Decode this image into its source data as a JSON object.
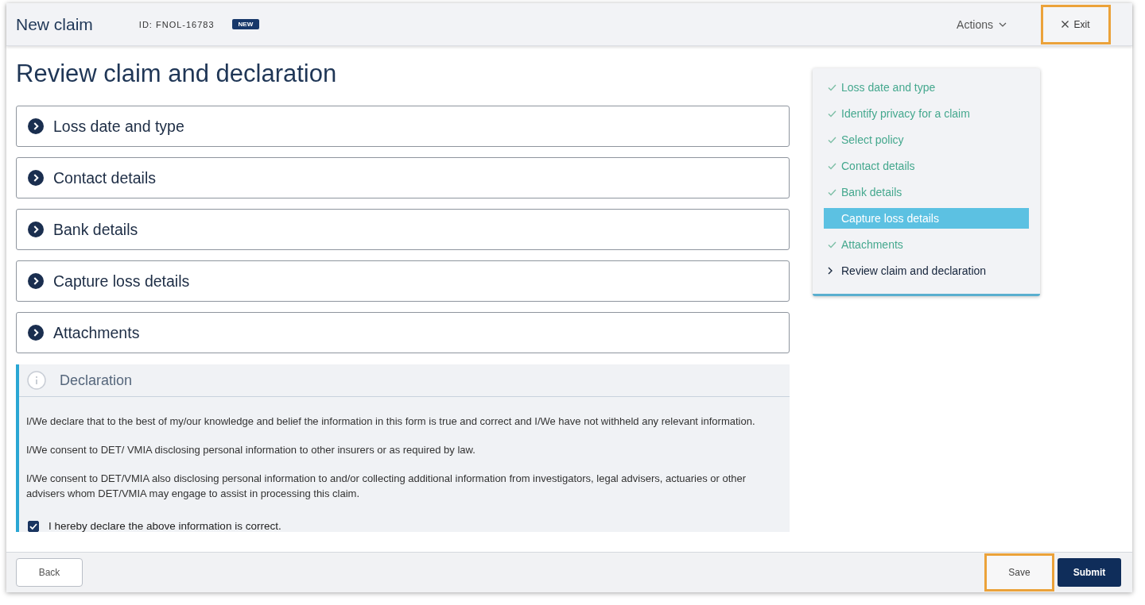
{
  "header": {
    "title": "New claim",
    "claim_id": "ID: FNOL-16783",
    "badge": "NEW",
    "actions_menu": {
      "label": "Actions"
    },
    "exit_button": {
      "label": "Exit",
      "highlighted": true
    }
  },
  "page_title": "Review claim and declaration",
  "sections": [
    {
      "label": "Loss date and type",
      "expanded": false
    },
    {
      "label": "Contact details",
      "expanded": false
    },
    {
      "label": "Bank details",
      "expanded": false
    },
    {
      "label": "Capture loss details",
      "expanded": false
    },
    {
      "label": "Attachments",
      "expanded": false
    }
  ],
  "declaration": {
    "title": "Declaration",
    "paragraphs": [
      "I/We declare that to the best of my/our knowledge and belief the information in this form is true and correct and I/We have not withheld any relevant information.",
      "I/We consent to DET/ VMIA disclosing personal information to other insurers or as required by law.",
      "I/We consent to DET/VMIA also disclosing personal information to and/or collecting additional information from investigators, legal advisers, actuaries or other advisers whom DET/VMIA may engage to assist in processing this claim."
    ],
    "confirm": {
      "label": "I hereby declare the above information is correct.",
      "checked": true
    }
  },
  "steps": [
    {
      "label": "Loss date and type",
      "kind": "done",
      "selected": false
    },
    {
      "label": "Identify privacy for a claim",
      "kind": "done",
      "selected": false
    },
    {
      "label": "Select policy",
      "kind": "done",
      "selected": false
    },
    {
      "label": "Contact details",
      "kind": "done",
      "selected": false
    },
    {
      "label": "Bank details",
      "kind": "done",
      "selected": false
    },
    {
      "label": "Capture loss details",
      "kind": "plain",
      "selected": true
    },
    {
      "label": "Attachments",
      "kind": "done",
      "selected": false
    },
    {
      "label": "Review claim and declaration",
      "kind": "current",
      "selected": false
    }
  ],
  "footer": {
    "left_buttons": [
      {
        "label": "Back",
        "kind": "secondary",
        "highlighted": false
      }
    ],
    "right_buttons": [
      {
        "label": "Save",
        "kind": "plain",
        "highlighted": true
      },
      {
        "label": "Submit",
        "kind": "primary",
        "highlighted": false
      }
    ]
  }
}
